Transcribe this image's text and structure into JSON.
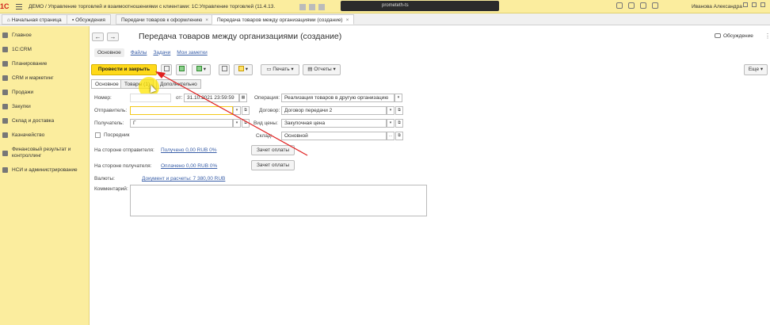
{
  "titlebar": {
    "logo": "1С",
    "app_title": "ДЕМО / Управление торговлей и взаимоотношениями с клиентами: 1С:Управление торговлей (11.4.13.",
    "recorder_label": "prometeth-ts",
    "user": "Иванова Александра"
  },
  "tabs": [
    {
      "label": "Начальная страница"
    },
    {
      "label": "Обсуждения"
    },
    {
      "label": "Передачи товаров к оформлению",
      "close": "×"
    },
    {
      "label": "Передача товаров между организациями (создание)",
      "close": "×"
    }
  ],
  "sidebar": {
    "items": [
      {
        "label": "Главное"
      },
      {
        "label": "1С:CRM"
      },
      {
        "label": "Планирование"
      },
      {
        "label": "CRM и маркетинг"
      },
      {
        "label": "Продажи"
      },
      {
        "label": "Закупки"
      },
      {
        "label": "Склад и доставка"
      },
      {
        "label": "Казначейство"
      },
      {
        "label": "Финансовый результат и контроллинг"
      },
      {
        "label": "НСИ и администрирование"
      }
    ]
  },
  "header": {
    "back": "←",
    "forward": "→",
    "title": "Передача товаров между организациями (создание)",
    "discussion": "Обсуждение",
    "more_icon": "⋮"
  },
  "subnav": {
    "current": "Основное",
    "links": [
      "Файлы",
      "Задачи",
      "Мои заметки"
    ]
  },
  "toolbar": {
    "post_close": "Провести и закрыть",
    "print": "Печать",
    "reports": "Отчеты",
    "more": "Еще",
    "arrow": "▾"
  },
  "form_tabs": [
    "Основное",
    "Товары (1)",
    "Дополнительно"
  ],
  "form": {
    "number_label": "Номер:",
    "number_value": "",
    "date_label": "от:",
    "date_value": "31.10.2021 23:59:59",
    "operation_label": "Операция:",
    "operation_value": "Реализация товаров в другую организацию",
    "sender_label": "Отправитель:",
    "sender_value": "",
    "contract_label": "Договор:",
    "contract_value": "Договор передачи 2",
    "receiver_label": "Получатель:",
    "receiver_value": "Г",
    "price_type_label": "Вид цены:",
    "price_type_value": "Закупочная цена",
    "intermediary_label": "Посредник",
    "warehouse_label": "Склад:",
    "warehouse_value": "Основной",
    "sender_side_label": "На стороне отправителя:",
    "sender_side_link": "Получено 0,00 RUB  0%",
    "receiver_side_label": "На стороне получателя:",
    "receiver_side_link": "Оплачено 0,00 RUB  0%",
    "offset_button": "Зачет оплаты",
    "currency_label": "Валюты:",
    "currency_link": "Документ и расчеты: 7 380,00 RUB",
    "comment_label": "Комментарий:",
    "dots": "...",
    "copy_icon": "⧉",
    "calendar_icon": "▦"
  },
  "colors": {
    "sidebar_bg": "#fbed9e",
    "accent_button": "#ffd919",
    "link": "#3a5fa8",
    "annotation_arrow": "#e02020"
  }
}
